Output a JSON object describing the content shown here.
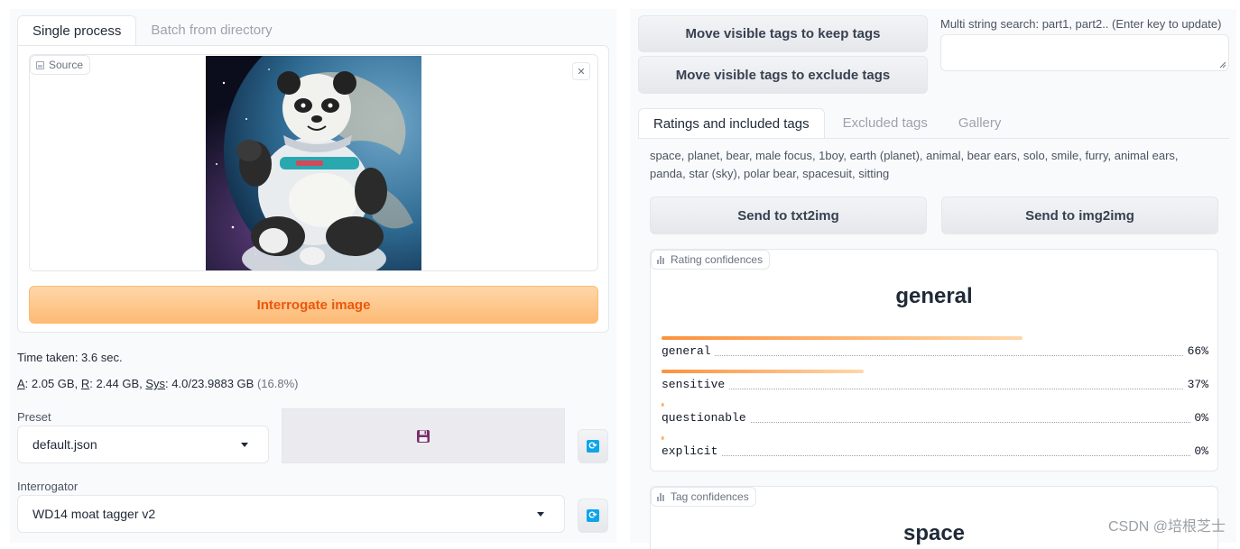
{
  "left": {
    "tabs": [
      {
        "label": "Single process"
      },
      {
        "label": "Batch from directory"
      }
    ],
    "source": {
      "label": "Source",
      "close_glyph": "✕"
    },
    "interrogate_button": "Interrogate image",
    "time_taken": "Time taken: 3.6 sec.",
    "memory": {
      "a_key": "A",
      "a_val": ": 2.05 GB, ",
      "r_key": "R",
      "r_val": ": 2.44 GB, ",
      "sys_key": "Sys",
      "sys_val": ": 4.0/23.9883 GB ",
      "pct": "(16.8%)"
    },
    "preset": {
      "label": "Preset",
      "value": "default.json"
    },
    "save_icon": "floppy-disk-icon",
    "refresh_icon": "refresh-icon",
    "interrogator": {
      "label": "Interrogator",
      "value": "WD14 moat tagger v2"
    }
  },
  "right": {
    "move_keep_button": "Move visible tags to keep tags",
    "move_exclude_button": "Move visible tags to exclude tags",
    "search": {
      "label": "Multi string search: part1, part2.. (Enter key to update)",
      "value": ""
    },
    "tabs": [
      {
        "label": "Ratings and included tags"
      },
      {
        "label": "Excluded tags"
      },
      {
        "label": "Gallery"
      }
    ],
    "tags_text": "space, planet, bear, male focus, 1boy, earth (planet), animal, bear ears, solo, smile, furry, animal ears, panda, star (sky), polar bear, spacesuit, sitting",
    "send_txt2img": "Send to txt2img",
    "send_img2img": "Send to img2img",
    "rating": {
      "label": "Rating confidences",
      "top": "general",
      "items": [
        {
          "name": "general",
          "value": 0.66,
          "pct": "66%"
        },
        {
          "name": "sensitive",
          "value": 0.37,
          "pct": "37%"
        },
        {
          "name": "questionable",
          "value": 0.0,
          "pct": "0%"
        },
        {
          "name": "explicit",
          "value": 0.0,
          "pct": "0%"
        }
      ]
    },
    "tag_conf": {
      "label": "Tag confidences",
      "top": "space"
    }
  },
  "watermark": "CSDN @培根芝士",
  "colors": {
    "accent": "#ea580c",
    "accent_light": "#fed7aa",
    "refresh": "#0ea5e9"
  }
}
